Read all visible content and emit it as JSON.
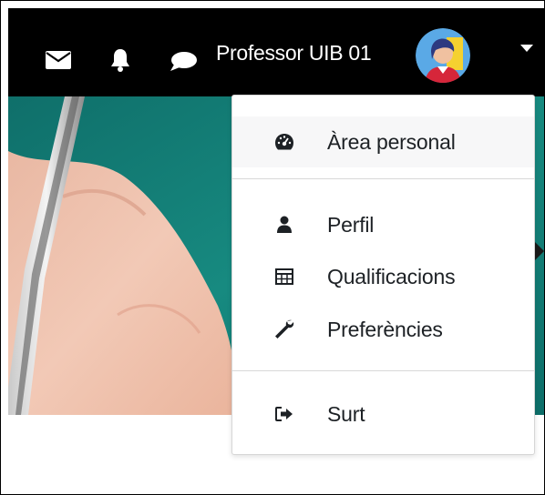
{
  "navbar": {
    "icons": {
      "messages": "envelope-icon",
      "notifications": "bell-icon",
      "chat": "speech-bubble-icon",
      "menu_toggle": "caret-down-icon"
    },
    "user_name": "Professor UIB 01",
    "avatar": "user-avatar"
  },
  "user_menu": {
    "items": [
      {
        "label": "Àrea personal",
        "icon": "dashboard-gauge-icon"
      },
      {
        "label": "Perfil",
        "icon": "user-icon"
      },
      {
        "label": "Qualificacions",
        "icon": "table-grid-icon"
      },
      {
        "label": "Preferències",
        "icon": "wrench-icon"
      },
      {
        "label": "Surt",
        "icon": "sign-out-icon"
      }
    ]
  },
  "colors": {
    "navbar_bg": "#000000",
    "hero_teal": "#127d76",
    "menu_text": "#1d2125"
  }
}
